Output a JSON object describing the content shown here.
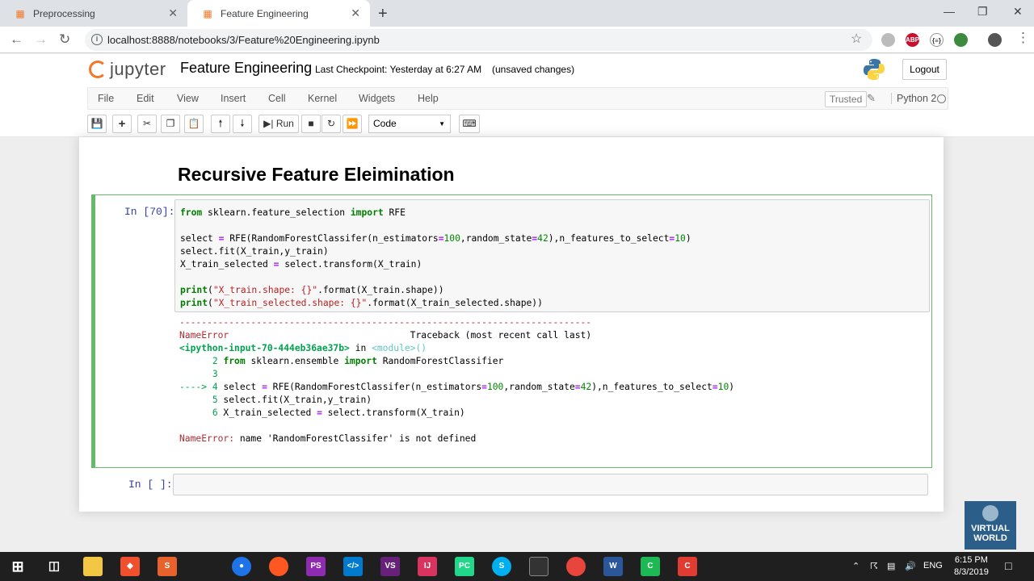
{
  "browser": {
    "tabs": [
      {
        "title": "Preprocessing",
        "icon": "jupyter-favicon-icon"
      },
      {
        "title": "Feature Engineering",
        "icon": "jupyter-favicon-icon"
      }
    ],
    "url": "localhost:8888/notebooks/3/Feature%20Engineering.ipynb"
  },
  "header": {
    "logo_text": "jupyter",
    "notebook_title": "Feature Engineering",
    "checkpoint": "Last Checkpoint: Yesterday at 6:27 AM",
    "unsaved": "(unsaved changes)",
    "logout": "Logout"
  },
  "menu": {
    "items": [
      "File",
      "Edit",
      "View",
      "Insert",
      "Cell",
      "Kernel",
      "Widgets",
      "Help"
    ],
    "trusted": "Trusted",
    "kernel": "Python 2"
  },
  "toolbar": {
    "run_label": "Run",
    "cell_type": "Code"
  },
  "notebook": {
    "heading": "Recursive Feature Eleimination",
    "cell1_prompt": "In [70]:",
    "cell2_prompt": "In [ ]:",
    "code_lines": [
      "from sklearn.feature_selection import RFE",
      "",
      "select = RFE(RandomForestClassifer(n_estimators=100,random_state=42),n_features_to_select=10)",
      "select.fit(X_train,y_train)",
      "X_train_selected = select.transform(X_train)",
      "",
      "print(\"X_train.shape: {}\".format(X_train.shape))",
      "print(\"X_train_selected.shape: {}\".format(X_train_selected.shape))"
    ],
    "traceback": {
      "separator": "---------------------------------------------------------------------------",
      "error_name": "NameError",
      "traceback_header": "Traceback (most recent call last)",
      "location": "<ipython-input-70-444eb36ae37b>",
      "location_in": "in",
      "module": "<module>()",
      "lines": [
        {
          "num": "2",
          "arrow": "",
          "code": "from sklearn.ensemble import RandomForestClassifier"
        },
        {
          "num": "3",
          "arrow": "",
          "code": ""
        },
        {
          "num": "4",
          "arrow": "---->",
          "code": "select = RFE(RandomForestClassifer(n_estimators=100,random_state=42),n_features_to_select=10)"
        },
        {
          "num": "5",
          "arrow": "",
          "code": "select.fit(X_train,y_train)"
        },
        {
          "num": "6",
          "arrow": "",
          "code": "X_train_selected = select.transform(X_train)"
        }
      ],
      "final_error_name": "NameError:",
      "final_error_msg": "name 'RandomForestClassifer' is not defined"
    }
  },
  "watermark": {
    "line1": "VIRTUAL",
    "line2": "WORLD"
  },
  "taskbar": {
    "language": "ENG",
    "time": "6:15 PM",
    "date": "8/3/2019"
  }
}
